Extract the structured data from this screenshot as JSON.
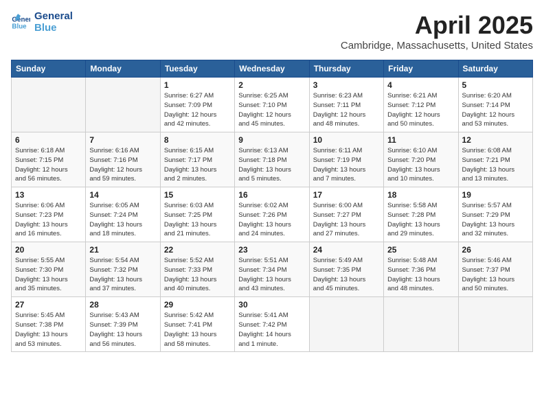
{
  "header": {
    "logo_line1": "General",
    "logo_line2": "Blue",
    "month_title": "April 2025",
    "location": "Cambridge, Massachusetts, United States"
  },
  "weekdays": [
    "Sunday",
    "Monday",
    "Tuesday",
    "Wednesday",
    "Thursday",
    "Friday",
    "Saturday"
  ],
  "weeks": [
    [
      {
        "day": "",
        "info": ""
      },
      {
        "day": "",
        "info": ""
      },
      {
        "day": "1",
        "info": "Sunrise: 6:27 AM\nSunset: 7:09 PM\nDaylight: 12 hours\nand 42 minutes."
      },
      {
        "day": "2",
        "info": "Sunrise: 6:25 AM\nSunset: 7:10 PM\nDaylight: 12 hours\nand 45 minutes."
      },
      {
        "day": "3",
        "info": "Sunrise: 6:23 AM\nSunset: 7:11 PM\nDaylight: 12 hours\nand 48 minutes."
      },
      {
        "day": "4",
        "info": "Sunrise: 6:21 AM\nSunset: 7:12 PM\nDaylight: 12 hours\nand 50 minutes."
      },
      {
        "day": "5",
        "info": "Sunrise: 6:20 AM\nSunset: 7:14 PM\nDaylight: 12 hours\nand 53 minutes."
      }
    ],
    [
      {
        "day": "6",
        "info": "Sunrise: 6:18 AM\nSunset: 7:15 PM\nDaylight: 12 hours\nand 56 minutes."
      },
      {
        "day": "7",
        "info": "Sunrise: 6:16 AM\nSunset: 7:16 PM\nDaylight: 12 hours\nand 59 minutes."
      },
      {
        "day": "8",
        "info": "Sunrise: 6:15 AM\nSunset: 7:17 PM\nDaylight: 13 hours\nand 2 minutes."
      },
      {
        "day": "9",
        "info": "Sunrise: 6:13 AM\nSunset: 7:18 PM\nDaylight: 13 hours\nand 5 minutes."
      },
      {
        "day": "10",
        "info": "Sunrise: 6:11 AM\nSunset: 7:19 PM\nDaylight: 13 hours\nand 7 minutes."
      },
      {
        "day": "11",
        "info": "Sunrise: 6:10 AM\nSunset: 7:20 PM\nDaylight: 13 hours\nand 10 minutes."
      },
      {
        "day": "12",
        "info": "Sunrise: 6:08 AM\nSunset: 7:21 PM\nDaylight: 13 hours\nand 13 minutes."
      }
    ],
    [
      {
        "day": "13",
        "info": "Sunrise: 6:06 AM\nSunset: 7:23 PM\nDaylight: 13 hours\nand 16 minutes."
      },
      {
        "day": "14",
        "info": "Sunrise: 6:05 AM\nSunset: 7:24 PM\nDaylight: 13 hours\nand 18 minutes."
      },
      {
        "day": "15",
        "info": "Sunrise: 6:03 AM\nSunset: 7:25 PM\nDaylight: 13 hours\nand 21 minutes."
      },
      {
        "day": "16",
        "info": "Sunrise: 6:02 AM\nSunset: 7:26 PM\nDaylight: 13 hours\nand 24 minutes."
      },
      {
        "day": "17",
        "info": "Sunrise: 6:00 AM\nSunset: 7:27 PM\nDaylight: 13 hours\nand 27 minutes."
      },
      {
        "day": "18",
        "info": "Sunrise: 5:58 AM\nSunset: 7:28 PM\nDaylight: 13 hours\nand 29 minutes."
      },
      {
        "day": "19",
        "info": "Sunrise: 5:57 AM\nSunset: 7:29 PM\nDaylight: 13 hours\nand 32 minutes."
      }
    ],
    [
      {
        "day": "20",
        "info": "Sunrise: 5:55 AM\nSunset: 7:30 PM\nDaylight: 13 hours\nand 35 minutes."
      },
      {
        "day": "21",
        "info": "Sunrise: 5:54 AM\nSunset: 7:32 PM\nDaylight: 13 hours\nand 37 minutes."
      },
      {
        "day": "22",
        "info": "Sunrise: 5:52 AM\nSunset: 7:33 PM\nDaylight: 13 hours\nand 40 minutes."
      },
      {
        "day": "23",
        "info": "Sunrise: 5:51 AM\nSunset: 7:34 PM\nDaylight: 13 hours\nand 43 minutes."
      },
      {
        "day": "24",
        "info": "Sunrise: 5:49 AM\nSunset: 7:35 PM\nDaylight: 13 hours\nand 45 minutes."
      },
      {
        "day": "25",
        "info": "Sunrise: 5:48 AM\nSunset: 7:36 PM\nDaylight: 13 hours\nand 48 minutes."
      },
      {
        "day": "26",
        "info": "Sunrise: 5:46 AM\nSunset: 7:37 PM\nDaylight: 13 hours\nand 50 minutes."
      }
    ],
    [
      {
        "day": "27",
        "info": "Sunrise: 5:45 AM\nSunset: 7:38 PM\nDaylight: 13 hours\nand 53 minutes."
      },
      {
        "day": "28",
        "info": "Sunrise: 5:43 AM\nSunset: 7:39 PM\nDaylight: 13 hours\nand 56 minutes."
      },
      {
        "day": "29",
        "info": "Sunrise: 5:42 AM\nSunset: 7:41 PM\nDaylight: 13 hours\nand 58 minutes."
      },
      {
        "day": "30",
        "info": "Sunrise: 5:41 AM\nSunset: 7:42 PM\nDaylight: 14 hours\nand 1 minute."
      },
      {
        "day": "",
        "info": ""
      },
      {
        "day": "",
        "info": ""
      },
      {
        "day": "",
        "info": ""
      }
    ]
  ]
}
